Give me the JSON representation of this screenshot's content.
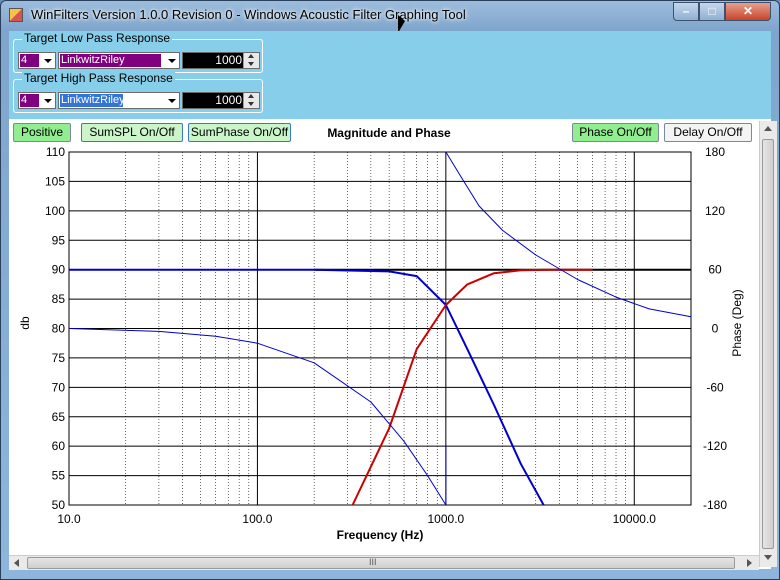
{
  "window": {
    "title": "WinFilters Version 1.0.0 Revision 0 - Windows Acoustic Filter Graphing Tool",
    "min_symbol": "–",
    "max_symbol": "□",
    "close_symbol": "✕"
  },
  "low_pass": {
    "group_title": "Target Low Pass Response",
    "order": "4",
    "type": "LinkwitzRiley",
    "frequency": "1000"
  },
  "high_pass": {
    "group_title": "Target High Pass Response",
    "order": "4",
    "type": "LinkwitzRiley",
    "frequency": "1000"
  },
  "toolbar": {
    "positive": "Positive",
    "sum_spl": "SumSPL On/Off",
    "sum_phase": "SumPhase On/Off",
    "phase": "Phase On/Off",
    "delay": "Delay On/Off"
  },
  "scrollbar": {
    "grip": "III"
  },
  "chart_data": {
    "type": "line",
    "title": "Magnitude and Phase",
    "xlabel": "Frequency (Hz)",
    "ylabel": "db",
    "y2label": "Phase (Deg)",
    "x_scale": "log",
    "xlim": [
      10,
      20000
    ],
    "ylim": [
      50,
      110
    ],
    "y2lim": [
      -180,
      180
    ],
    "xticks": [
      "10.0",
      "100.0",
      "1000.0",
      "10000.0"
    ],
    "yticks": [
      "50",
      "55",
      "60",
      "65",
      "70",
      "75",
      "80",
      "85",
      "90",
      "95",
      "100",
      "105",
      "110"
    ],
    "y2ticks": [
      "-180",
      "-120",
      "-60",
      "0",
      "60",
      "120",
      "180"
    ],
    "grid": true,
    "series": [
      {
        "color": "#000000",
        "axis": "db",
        "x": [
          200,
          1000,
          20000
        ],
        "y": [
          90,
          90,
          90
        ]
      },
      {
        "color": "#0000cc",
        "axis": "db",
        "x": [
          10,
          200,
          500,
          700,
          1000,
          1300,
          1800,
          2500,
          3300
        ],
        "y": [
          90,
          90,
          89.7,
          88.9,
          84,
          76.5,
          67,
          57,
          50
        ]
      },
      {
        "color": "#cc0000",
        "axis": "db",
        "x": [
          320,
          500,
          700,
          1000,
          1300,
          1800,
          2500,
          3500,
          6000
        ],
        "y": [
          50,
          63,
          76.5,
          84,
          87.5,
          89.4,
          89.9,
          90,
          90
        ]
      },
      {
        "color": "#0000cc",
        "axis": "phase",
        "x": [
          10,
          30,
          60,
          100,
          200,
          400,
          600,
          800,
          1000
        ],
        "y": [
          0,
          -3,
          -8,
          -15,
          -35,
          -75,
          -115,
          -150,
          -180
        ]
      },
      {
        "color": "#0000cc",
        "axis": "phase",
        "x": [
          1000,
          1200,
          1500,
          2000,
          3000,
          5000,
          8000,
          12000,
          20000
        ],
        "y": [
          180,
          155,
          125,
          100,
          75,
          50,
          32,
          20,
          12
        ]
      },
      {
        "color": "#0000cc",
        "axis": "phase",
        "x": [
          1000,
          1000
        ],
        "y": [
          -180,
          -120
        ]
      }
    ]
  }
}
